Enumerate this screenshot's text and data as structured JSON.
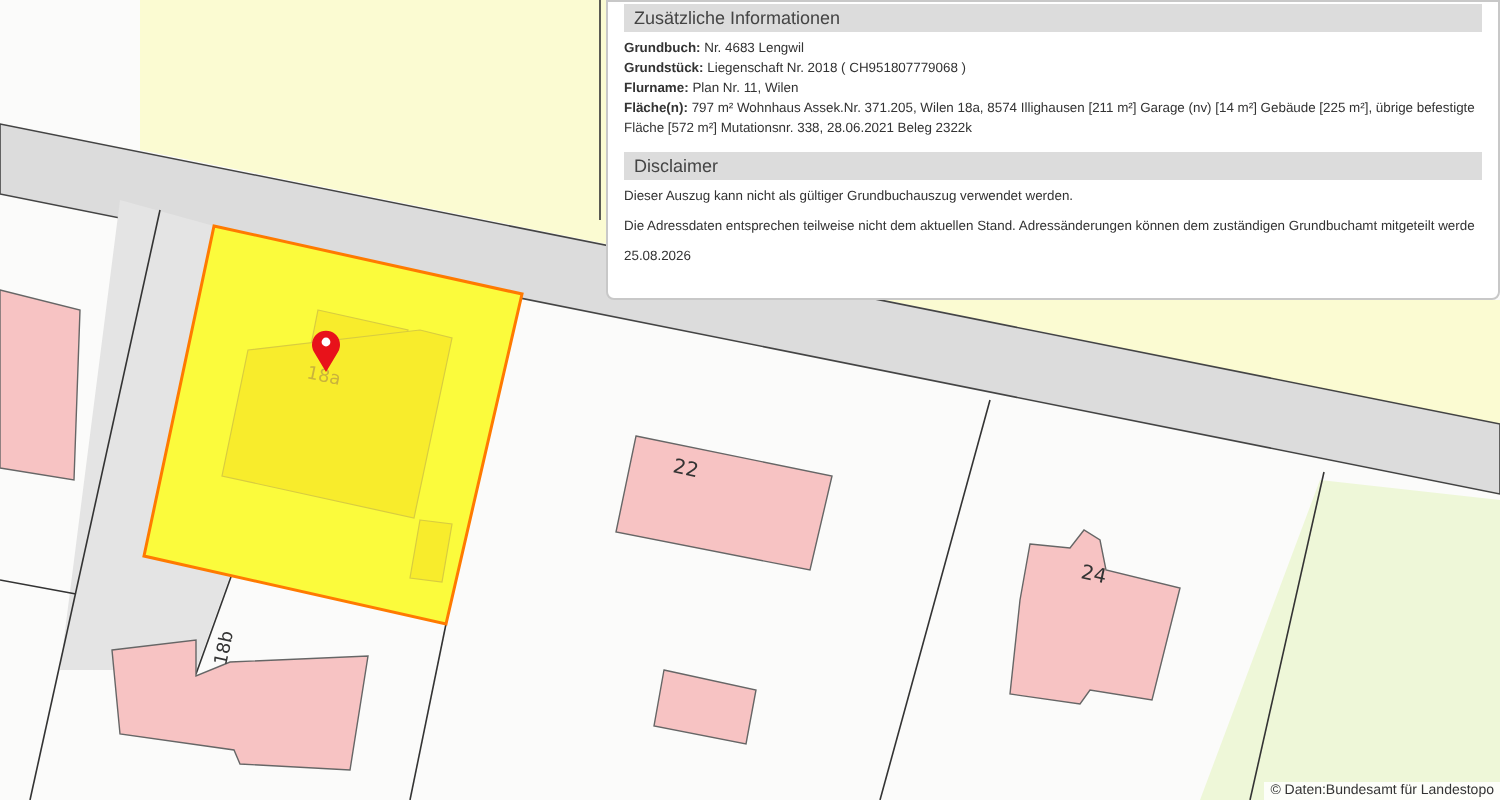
{
  "map": {
    "labels": [
      {
        "kind": "building-number",
        "text": "18a"
      },
      {
        "kind": "building-number",
        "text": "22"
      },
      {
        "kind": "building-number",
        "text": "24"
      },
      {
        "kind": "building-number",
        "text": "18b"
      }
    ],
    "attribution": "© Daten:Bundesamt für Landestopo"
  },
  "info_panel": {
    "sections": [
      {
        "title": "Zusätzliche Informationen",
        "kind": "fields",
        "fields": [
          {
            "label": "Grundbuch:",
            "value": "Nr. 4683 Lengwil"
          },
          {
            "label": "Grundstück:",
            "value": "Liegenschaft Nr. 2018 ( CH951807779068 )"
          },
          {
            "label": "Flurname:",
            "value": "Plan Nr. 11, Wilen"
          },
          {
            "label": "Fläche(n):",
            "value": "797 m² Wohnhaus Assek.Nr. 371.205, Wilen 18a, 8574 Illighausen [211 m²] Garage (nv) [14 m²] Gebäude [225 m²], übrige befestigte Fläche [572 m²] Mutationsnr. 338, 28.06.2021 Beleg 2322k"
          }
        ]
      },
      {
        "title": "Disclaimer",
        "kind": "paragraphs",
        "paragraphs": [
          "Dieser Auszug kann nicht als gültiger Grundbuchauszug verwendet werden.",
          "Die Adressdaten entsprechen teilweise nicht dem aktuellen Stand. Adressänderungen können dem zuständigen Grundbuchamt mitgeteilt werde",
          "25.08.2026"
        ]
      }
    ]
  }
}
